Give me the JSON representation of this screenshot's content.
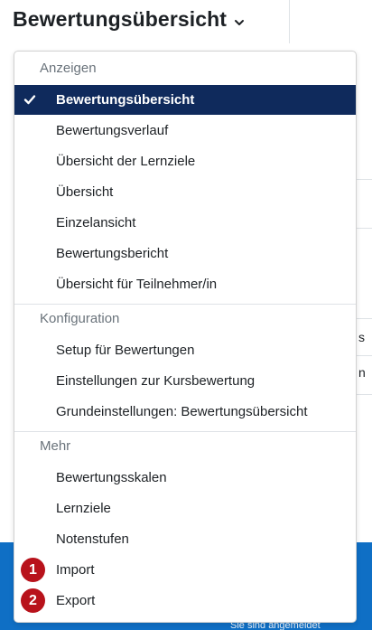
{
  "header": {
    "title": "Bewertungsübersicht"
  },
  "background": {
    "cut_s": "s",
    "cut_n": "n",
    "footer_text": "Sie sind angemeldet"
  },
  "menu": {
    "sections": [
      {
        "heading": "Anzeigen",
        "items": [
          {
            "label": "Bewertungsübersicht",
            "active": true
          },
          {
            "label": "Bewertungsverlauf"
          },
          {
            "label": "Übersicht der Lernziele"
          },
          {
            "label": "Übersicht"
          },
          {
            "label": "Einzelansicht"
          },
          {
            "label": "Bewertungsbericht"
          },
          {
            "label": "Übersicht für Teilnehmer/in"
          }
        ]
      },
      {
        "heading": "Konfiguration",
        "items": [
          {
            "label": "Setup für Bewertungen"
          },
          {
            "label": "Einstellungen zur Kursbewertung"
          },
          {
            "label": "Grundeinstellungen: Bewertungsübersicht"
          }
        ]
      },
      {
        "heading": "Mehr",
        "items": [
          {
            "label": "Bewertungsskalen"
          },
          {
            "label": "Lernziele"
          },
          {
            "label": "Notenstufen"
          },
          {
            "label": "Import",
            "badge": "1"
          },
          {
            "label": "Export",
            "badge": "2"
          }
        ]
      }
    ]
  },
  "colors": {
    "active_bg": "#0f2a5c",
    "badge_red": "#b8121b",
    "brand_blue": "#0f6fc5"
  }
}
